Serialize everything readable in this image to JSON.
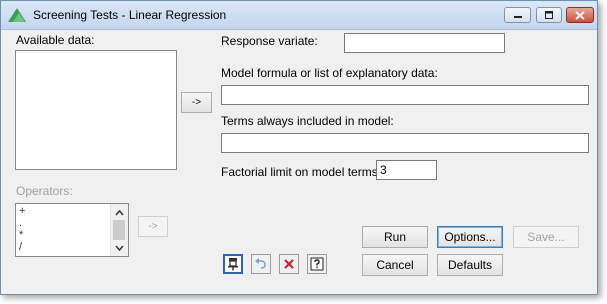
{
  "window": {
    "title": "Screening Tests - Linear Regression"
  },
  "labels": {
    "available_data": "Available data:",
    "response_variate": "Response variate:",
    "model_formula": "Model formula or list of explanatory data:",
    "terms_always": "Terms always included in model:",
    "factorial_limit": "Factorial limit on model terms:",
    "operators": "Operators:"
  },
  "fields": {
    "response_variate": "",
    "model_formula": "",
    "terms_always": "",
    "factorial_limit": "3"
  },
  "operators": [
    "+",
    ".",
    "*",
    "/"
  ],
  "buttons": {
    "arrow": "->",
    "run": "Run",
    "options": "Options...",
    "save": "Save...",
    "cancel": "Cancel",
    "defaults": "Defaults"
  },
  "icons": {
    "title": "genstat-logo-icon",
    "pin": "pin-icon",
    "undo": "undo-icon",
    "clear": "clear-icon",
    "help": "help-icon"
  },
  "colors": {
    "accent": "#2d62b8",
    "close_button": "#c7513d",
    "disabled_text": "#a0a0a0"
  }
}
